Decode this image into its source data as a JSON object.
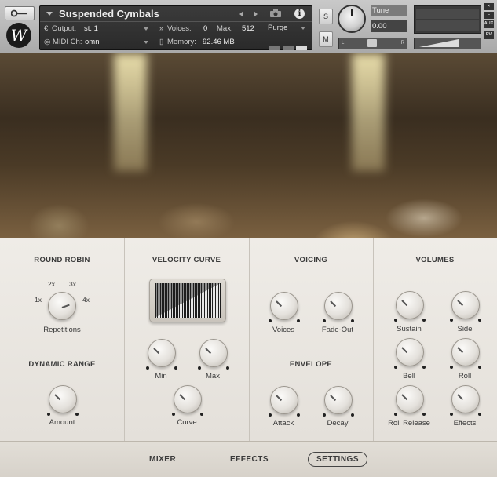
{
  "header": {
    "instrument_name": "Suspended Cymbals",
    "output_label": "Output:",
    "output_value": "st. 1",
    "voices_label": "Voices:",
    "voices_value": "0",
    "max_label": "Max:",
    "max_value": "512",
    "purge_label": "Purge",
    "midi_label": "MIDI Ch:",
    "midi_value": "omni",
    "memory_label": "Memory:",
    "memory_value": "92.46 MB",
    "solo_label": "S",
    "mute_label": "M",
    "tune_label": "Tune",
    "tune_value": "0.00",
    "pan_left": "L",
    "pan_right": "R",
    "close_label": "×",
    "minimize_label": "–",
    "aux_label": "AUX",
    "pv_label": "PV",
    "logo_letter": "W"
  },
  "sections": {
    "round_robin": {
      "title": "ROUND ROBIN",
      "opt_1x": "1x",
      "opt_2x": "2x",
      "opt_3x": "3x",
      "opt_4x": "4x",
      "knob_label": "Repetitions"
    },
    "dynamic_range": {
      "title": "DYNAMIC RANGE",
      "knob_label": "Amount"
    },
    "velocity_curve": {
      "title": "VELOCITY CURVE",
      "min_label": "Min",
      "max_label": "Max",
      "curve_label": "Curve"
    },
    "voicing": {
      "title": "VOICING",
      "voices_label": "Voices",
      "fadeout_label": "Fade-Out"
    },
    "envelope": {
      "title": "ENVELOPE",
      "attack_label": "Attack",
      "decay_label": "Decay"
    },
    "volumes": {
      "title": "VOLUMES",
      "sustain_label": "Sustain",
      "side_label": "Side",
      "bell_label": "Bell",
      "roll_label": "Roll",
      "roll_release_label": "Roll Release",
      "effects_label": "Effects"
    }
  },
  "nav": {
    "mixer": "MIXER",
    "effects": "EFFECTS",
    "settings": "SETTINGS"
  },
  "icons": {
    "wrench": "wrench-icon",
    "camera": "camera-icon",
    "info": "info-icon",
    "output": "output-icon",
    "midi": "midi-icon",
    "voices": "voices-icon",
    "memory": "memory-icon"
  },
  "colors": {
    "header_bg": "#b8b8b8",
    "panel_dark": "#2f2f2f",
    "controls_bg": "#ebe8e3",
    "text": "#3a3a3a"
  }
}
